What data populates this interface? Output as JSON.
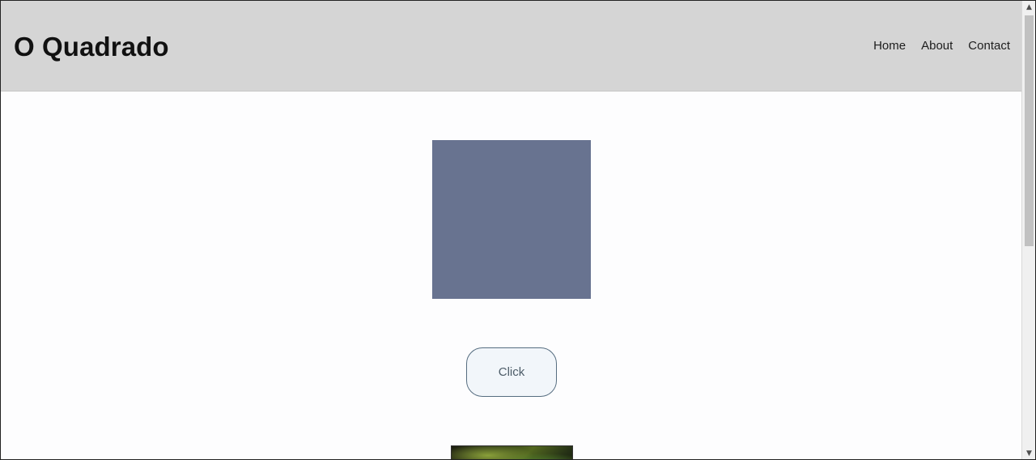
{
  "header": {
    "site_title": "O Quadrado",
    "nav": [
      {
        "label": "Home"
      },
      {
        "label": "About"
      },
      {
        "label": "Contact"
      }
    ]
  },
  "main": {
    "square_color": "#687390",
    "button_label": "Click"
  },
  "scrollbar": {
    "up_icon": "▲",
    "down_icon": "▼"
  },
  "colors": {
    "header_background": "#d5d5d5",
    "page_background": "#fdfdfe",
    "button_border": "#566d80"
  }
}
